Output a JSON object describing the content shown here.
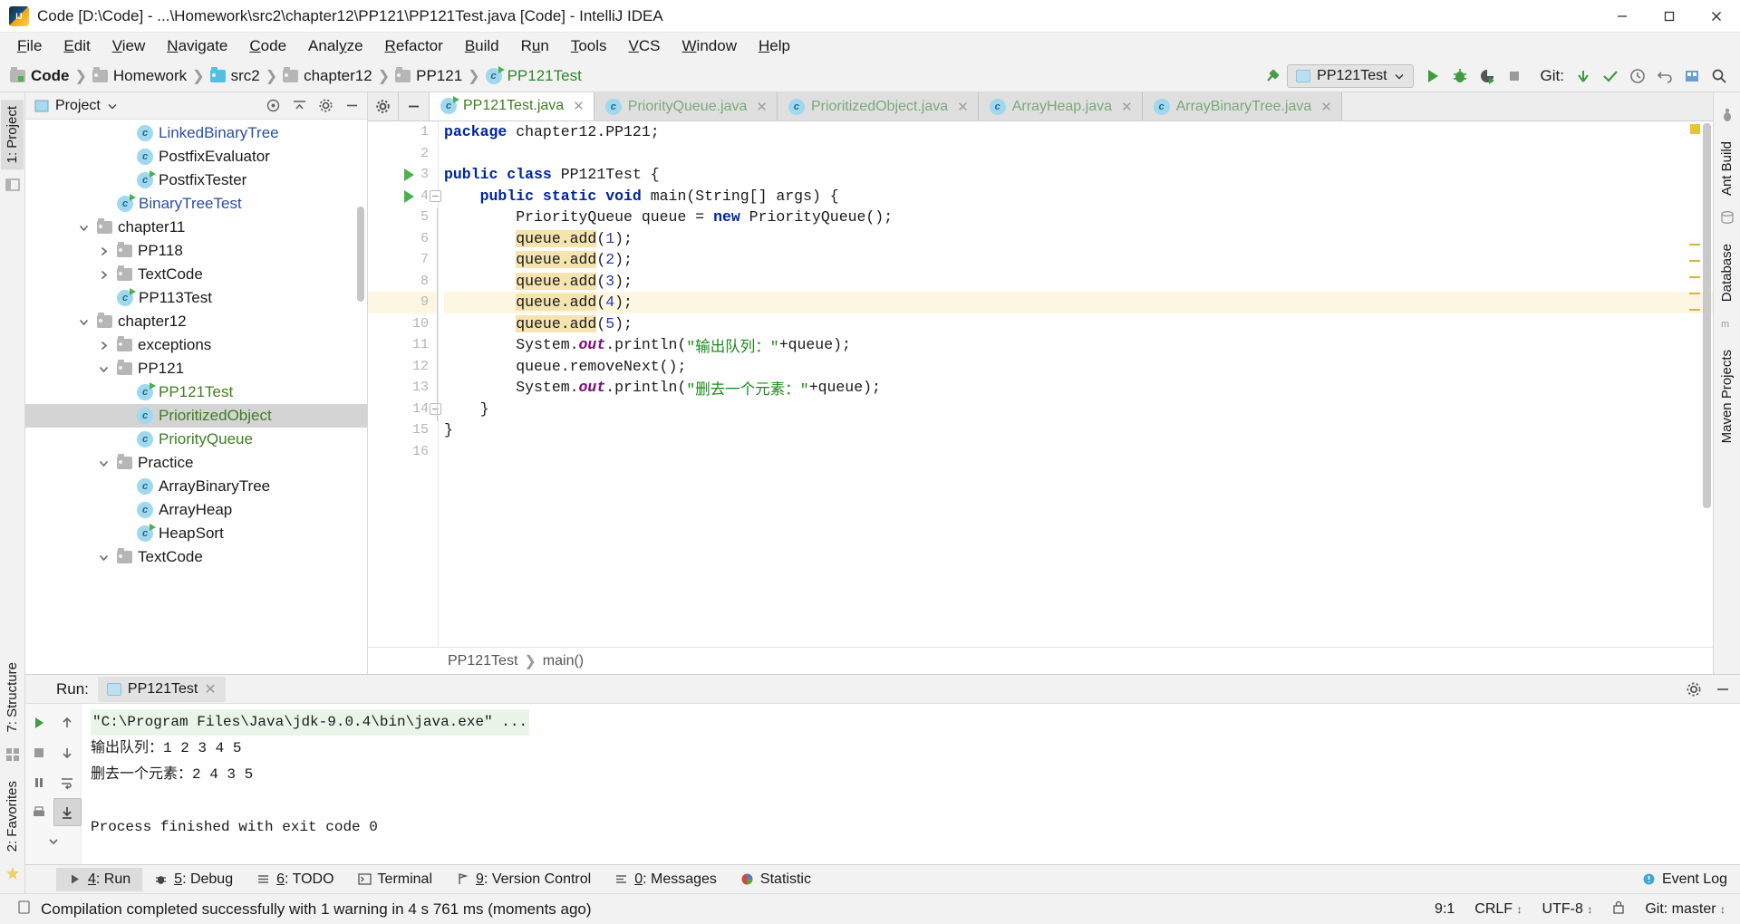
{
  "window": {
    "title": "Code [D:\\Code] - ...\\Homework\\src2\\chapter12\\PP121\\PP121Test.java [Code] - IntelliJ IDEA",
    "minimize": "—",
    "maximize": "❐",
    "close": "✕"
  },
  "menu": [
    {
      "label": "File",
      "mnemonic": "F"
    },
    {
      "label": "Edit",
      "mnemonic": "E"
    },
    {
      "label": "View",
      "mnemonic": "V"
    },
    {
      "label": "Navigate",
      "mnemonic": "N"
    },
    {
      "label": "Code",
      "mnemonic": "C"
    },
    {
      "label": "Analyze",
      "mnemonic": "y"
    },
    {
      "label": "Refactor",
      "mnemonic": "R"
    },
    {
      "label": "Build",
      "mnemonic": "B"
    },
    {
      "label": "Run",
      "mnemonic": "u"
    },
    {
      "label": "Tools",
      "mnemonic": "T"
    },
    {
      "label": "VCS",
      "mnemonic": "V"
    },
    {
      "label": "Window",
      "mnemonic": "W"
    },
    {
      "label": "Help",
      "mnemonic": "H"
    }
  ],
  "breadcrumb": [
    {
      "label": "Code",
      "icon": "module-folder-icon",
      "style": "bold"
    },
    {
      "label": "Homework",
      "icon": "folder-icon",
      "style": "normal"
    },
    {
      "label": "src2",
      "icon": "source-folder-icon",
      "style": "normal"
    },
    {
      "label": "chapter12",
      "icon": "folder-icon",
      "style": "normal"
    },
    {
      "label": "PP121",
      "icon": "folder-icon",
      "style": "normal"
    },
    {
      "label": "PP121Test",
      "icon": "class-icon",
      "style": "green"
    }
  ],
  "toolbar": {
    "build_icon": "hammer-icon",
    "run_config": "PP121Test",
    "run_icon": "run-icon",
    "debug_icon": "debug-icon",
    "coverage_icon": "run-with-coverage-icon",
    "stop_icon": "stop-icon",
    "git_label": "Git:",
    "update_icon": "update-project-icon",
    "commit_icon": "commit-icon",
    "history_icon": "history-icon",
    "rollback_icon": "rollback-icon",
    "settings_icon": "settings-icon",
    "search_icon": "search-icon"
  },
  "left_rail": [
    {
      "label": "1: Project",
      "selected": true
    },
    {
      "label": "2: Favorites",
      "selected": false
    },
    {
      "label": "7: Structure",
      "selected": false
    }
  ],
  "right_rail": [
    {
      "label": "Ant Build"
    },
    {
      "label": "Database"
    },
    {
      "label": "Maven Projects"
    }
  ],
  "project_panel": {
    "title": "Project",
    "dropdown_icon": "chevron-down-icon",
    "locate_icon": "locate-icon",
    "collapse_icon": "collapse-all-icon",
    "settings_icon": "gear-icon",
    "hide_icon": "hide-icon",
    "tree": [
      {
        "label": "LinkedBinaryTree",
        "indent": 4,
        "type": "class",
        "color": "blue",
        "arrow": "none",
        "runnable": false,
        "selected": false
      },
      {
        "label": "PostfixEvaluator",
        "indent": 4,
        "type": "class",
        "color": "dark",
        "arrow": "none",
        "runnable": false,
        "selected": false
      },
      {
        "label": "PostfixTester",
        "indent": 4,
        "type": "class",
        "color": "dark",
        "arrow": "none",
        "runnable": true,
        "selected": false
      },
      {
        "label": "BinaryTreeTest",
        "indent": 3,
        "type": "class",
        "color": "blue",
        "arrow": "none",
        "runnable": true,
        "selected": false
      },
      {
        "label": "chapter11",
        "indent": 2,
        "type": "folder",
        "color": "dark",
        "arrow": "down",
        "runnable": false,
        "selected": false
      },
      {
        "label": "PP118",
        "indent": 3,
        "type": "folder",
        "color": "dark",
        "arrow": "right",
        "runnable": false,
        "selected": false
      },
      {
        "label": "TextCode",
        "indent": 3,
        "type": "folder",
        "color": "dark",
        "arrow": "right",
        "runnable": false,
        "selected": false
      },
      {
        "label": "PP113Test",
        "indent": 3,
        "type": "class",
        "color": "dark",
        "arrow": "none",
        "runnable": true,
        "selected": false
      },
      {
        "label": "chapter12",
        "indent": 2,
        "type": "folder",
        "color": "dark",
        "arrow": "down",
        "runnable": false,
        "selected": false
      },
      {
        "label": "exceptions",
        "indent": 3,
        "type": "folder",
        "color": "dark",
        "arrow": "right",
        "runnable": false,
        "selected": false
      },
      {
        "label": "PP121",
        "indent": 3,
        "type": "folder",
        "color": "dark",
        "arrow": "down",
        "runnable": false,
        "selected": false
      },
      {
        "label": "PP121Test",
        "indent": 4,
        "type": "class",
        "color": "green",
        "arrow": "none",
        "runnable": true,
        "selected": false
      },
      {
        "label": "PrioritizedObject",
        "indent": 4,
        "type": "class",
        "color": "green",
        "arrow": "none",
        "runnable": false,
        "selected": true
      },
      {
        "label": "PriorityQueue",
        "indent": 4,
        "type": "class",
        "color": "green",
        "arrow": "none",
        "runnable": false,
        "selected": false
      },
      {
        "label": "Practice",
        "indent": 3,
        "type": "folder",
        "color": "dark",
        "arrow": "down",
        "runnable": false,
        "selected": false
      },
      {
        "label": "ArrayBinaryTree",
        "indent": 4,
        "type": "class",
        "color": "dark",
        "arrow": "none",
        "runnable": false,
        "selected": false
      },
      {
        "label": "ArrayHeap",
        "indent": 4,
        "type": "class",
        "color": "dark",
        "arrow": "none",
        "runnable": false,
        "selected": false
      },
      {
        "label": "HeapSort",
        "indent": 4,
        "type": "class",
        "color": "dark",
        "arrow": "none",
        "runnable": true,
        "selected": false
      },
      {
        "label": "TextCode",
        "indent": 3,
        "type": "folder",
        "color": "dark",
        "arrow": "down",
        "runnable": false,
        "selected": false
      }
    ]
  },
  "editor": {
    "gear_icon": "gear-icon",
    "minimize_icon": "minimize-icon",
    "tabs": [
      {
        "label": "PP121Test.java",
        "active": true,
        "runnable": true,
        "close": "✕"
      },
      {
        "label": "PriorityQueue.java",
        "active": false,
        "runnable": false,
        "close": "✕"
      },
      {
        "label": "PrioritizedObject.java",
        "active": false,
        "runnable": false,
        "close": "✕"
      },
      {
        "label": "ArrayHeap.java",
        "active": false,
        "runnable": false,
        "close": "✕"
      },
      {
        "label": "ArrayBinaryTree.java",
        "active": false,
        "runnable": false,
        "close": "✕"
      }
    ],
    "line_numbers": [
      "1",
      "2",
      "3",
      "4",
      "5",
      "6",
      "7",
      "8",
      "9",
      "10",
      "11",
      "12",
      "13",
      "14",
      "15",
      "16"
    ],
    "current_line": 9,
    "runnable_lines": [
      3,
      4
    ],
    "fold_lines": [
      4,
      14
    ],
    "breadcrumb_bottom": [
      "PP121Test",
      "main()"
    ],
    "code_lines": [
      {
        "n": 1,
        "tokens": [
          {
            "t": "package",
            "c": "kw"
          },
          {
            "t": " chapter12.PP121;",
            "c": "pl"
          }
        ]
      },
      {
        "n": 2,
        "tokens": []
      },
      {
        "n": 3,
        "tokens": [
          {
            "t": "public class",
            "c": "kw"
          },
          {
            "t": " PP121Test {",
            "c": "pl"
          }
        ]
      },
      {
        "n": 4,
        "tokens": [
          {
            "t": "    ",
            "c": "pl"
          },
          {
            "t": "public static void",
            "c": "kw"
          },
          {
            "t": " main(String[] args) {",
            "c": "pl"
          }
        ]
      },
      {
        "n": 5,
        "tokens": [
          {
            "t": "        PriorityQueue queue = ",
            "c": "pl"
          },
          {
            "t": "new",
            "c": "kw"
          },
          {
            "t": " PriorityQueue();",
            "c": "pl"
          }
        ]
      },
      {
        "n": 6,
        "tokens": [
          {
            "t": "        ",
            "c": "pl"
          },
          {
            "t": "queue.add",
            "c": "hl"
          },
          {
            "t": "(",
            "c": "pl"
          },
          {
            "t": "1",
            "c": "num"
          },
          {
            "t": ");",
            "c": "pl"
          }
        ]
      },
      {
        "n": 7,
        "tokens": [
          {
            "t": "        ",
            "c": "pl"
          },
          {
            "t": "queue.add",
            "c": "hl"
          },
          {
            "t": "(",
            "c": "pl"
          },
          {
            "t": "2",
            "c": "num"
          },
          {
            "t": ");",
            "c": "pl"
          }
        ]
      },
      {
        "n": 8,
        "tokens": [
          {
            "t": "        ",
            "c": "pl"
          },
          {
            "t": "queue.add",
            "c": "hl"
          },
          {
            "t": "(",
            "c": "pl"
          },
          {
            "t": "3",
            "c": "num"
          },
          {
            "t": ");",
            "c": "pl"
          }
        ]
      },
      {
        "n": 9,
        "tokens": [
          {
            "t": "        ",
            "c": "pl"
          },
          {
            "t": "queue.add",
            "c": "hl"
          },
          {
            "t": "(",
            "c": "pl"
          },
          {
            "t": "4",
            "c": "num"
          },
          {
            "t": ");",
            "c": "pl"
          }
        ]
      },
      {
        "n": 10,
        "tokens": [
          {
            "t": "        ",
            "c": "pl"
          },
          {
            "t": "queue.add",
            "c": "hl"
          },
          {
            "t": "(",
            "c": "pl"
          },
          {
            "t": "5",
            "c": "num"
          },
          {
            "t": ");",
            "c": "pl"
          }
        ]
      },
      {
        "n": 11,
        "tokens": [
          {
            "t": "        System.",
            "c": "pl"
          },
          {
            "t": "out",
            "c": "fld"
          },
          {
            "t": ".println(",
            "c": "pl"
          },
          {
            "t": "\"输出队列：\"",
            "c": "str"
          },
          {
            "t": "+queue);",
            "c": "pl"
          }
        ]
      },
      {
        "n": 12,
        "tokens": [
          {
            "t": "        queue.removeNext();",
            "c": "pl"
          }
        ]
      },
      {
        "n": 13,
        "tokens": [
          {
            "t": "        System.",
            "c": "pl"
          },
          {
            "t": "out",
            "c": "fld"
          },
          {
            "t": ".println(",
            "c": "pl"
          },
          {
            "t": "\"删去一个元素：\"",
            "c": "str"
          },
          {
            "t": "+queue);",
            "c": "pl"
          }
        ]
      },
      {
        "n": 14,
        "tokens": [
          {
            "t": "    }",
            "c": "pl"
          }
        ]
      },
      {
        "n": 15,
        "tokens": [
          {
            "t": "}",
            "c": "pl"
          }
        ]
      },
      {
        "n": 16,
        "tokens": []
      }
    ]
  },
  "run_panel": {
    "label": "Run:",
    "tab_name": "PP121Test",
    "tab_close": "✕",
    "settings_icon": "gear-icon",
    "hide_icon": "hide-icon",
    "side_buttons": [
      {
        "name": "rerun-icon",
        "active": false
      },
      {
        "name": "up-stack-icon",
        "active": false
      },
      {
        "name": "stop-icon",
        "active": false
      },
      {
        "name": "down-stack-icon",
        "active": false
      },
      {
        "name": "pause-icon",
        "active": false
      },
      {
        "name": "soft-wrap-icon",
        "active": false
      },
      {
        "name": "print-icon",
        "active": false
      },
      {
        "name": "scroll-to-end-icon",
        "active": true
      },
      {
        "name": "more-icon",
        "active": false
      }
    ],
    "console": [
      {
        "text": "\"C:\\Program Files\\Java\\jdk-9.0.4\\bin\\java.exe\" ...",
        "style": "cmd"
      },
      {
        "text": "输出队列：1  2  3  4  5",
        "style": "normal"
      },
      {
        "text": "删去一个元素：2  4  3  5",
        "style": "normal"
      },
      {
        "text": "",
        "style": "blank"
      },
      {
        "text": "Process finished with exit code 0",
        "style": "normal"
      }
    ]
  },
  "bottom_tabs": [
    {
      "label": "4: Run",
      "mnemonic": "4",
      "icon": "run-icon",
      "selected": true
    },
    {
      "label": "5: Debug",
      "mnemonic": "5",
      "icon": "debug-icon",
      "selected": false
    },
    {
      "label": "6: TODO",
      "mnemonic": "6",
      "icon": "todo-icon",
      "selected": false
    },
    {
      "label": "Terminal",
      "mnemonic": "",
      "icon": "terminal-icon",
      "selected": false
    },
    {
      "label": "9: Version Control",
      "mnemonic": "9",
      "icon": "vcs-icon",
      "selected": false
    },
    {
      "label": "0: Messages",
      "mnemonic": "0",
      "icon": "messages-icon",
      "selected": false
    },
    {
      "label": "Statistic",
      "mnemonic": "",
      "icon": "statistic-icon",
      "selected": false
    }
  ],
  "event_log": {
    "label": "Event Log",
    "icon": "event-log-icon"
  },
  "status_bar": {
    "message": "Compilation completed successfully with 1 warning in 4 s 761 ms (moments ago)",
    "message_icon": "notification-icon",
    "caret": "9:1",
    "line_ending": "CRLF",
    "encoding": "UTF-8",
    "git_branch": "Git: master",
    "lock_icon": "lock-icon"
  },
  "colors": {
    "accent_green": "#3f7d20",
    "keyword_blue": "#00259b",
    "string_green": "#1a8a1a",
    "highlight_yellow": "#f5e4b0",
    "current_line": "#fdf6e3",
    "selection_gray": "#d4d4d4"
  }
}
